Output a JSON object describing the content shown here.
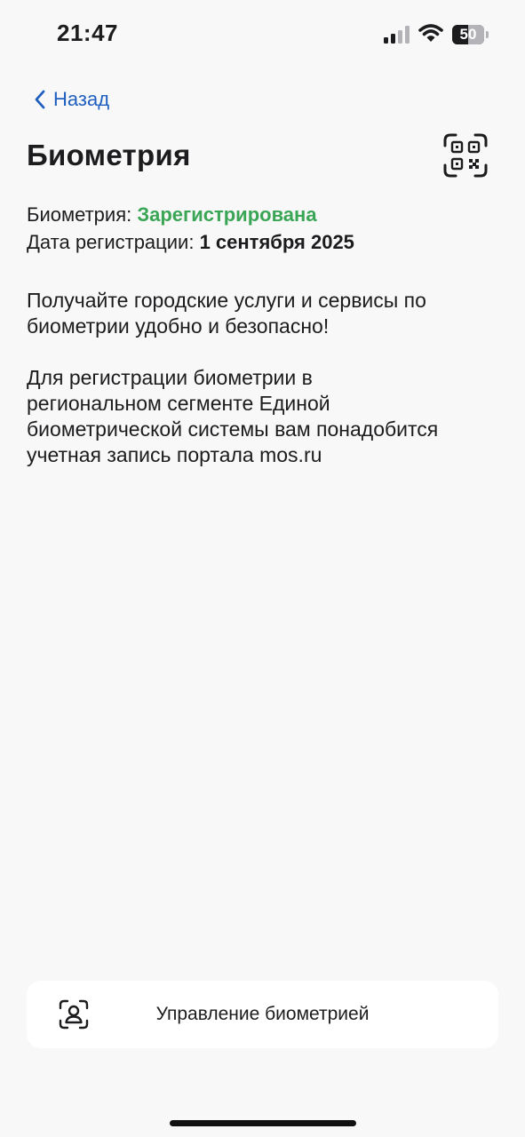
{
  "status_bar": {
    "time": "21:47",
    "battery_level": "50",
    "battery_fraction": 0.5,
    "signal_bars_active": 2,
    "signal_bars_total": 4
  },
  "nav": {
    "back_label": "Назад",
    "back_icon": "chevron-left-icon"
  },
  "header": {
    "title": "Биометрия",
    "qr_icon": "qr-scan-icon"
  },
  "info": {
    "status_label": "Биометрия: ",
    "status_value": "Зарегистрирована",
    "date_label": "Дата регистрации: ",
    "date_value": "1 сентября 2025"
  },
  "body": {
    "paragraph1_lines": [
      "Получайте городские услуги и сервисы по",
      "биометрии удобно и безопасно!"
    ],
    "paragraph2_lines": [
      "Для регистрации биометрии в",
      "региональном сегменте Единой",
      "биометрической системы вам понадобится",
      "учетная запись портала mos.ru"
    ]
  },
  "action": {
    "manage_label": "Управление биометрией",
    "manage_icon": "face-scan-icon"
  },
  "colors": {
    "accent": "#1f5fbf",
    "success": "#3aa655",
    "background": "#f8f8f8",
    "card": "#ffffff",
    "text": "#1c1c1e"
  }
}
